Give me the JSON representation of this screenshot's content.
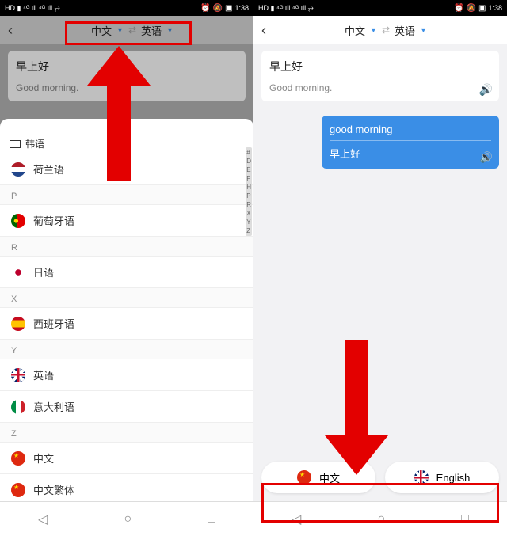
{
  "status": {
    "left": "HD ▮ ⁴ᴳ.ıll ⁴ᴳ.ıll ⥂",
    "alarm": "⏰",
    "mute": "🔕",
    "batt": "▣",
    "time": "1:38"
  },
  "top": {
    "src": "中文",
    "dst": "英语"
  },
  "leftCard": {
    "src": "早上好",
    "dst": "Good morning."
  },
  "sheetTop": "韩语",
  "sections": [
    {
      "h": "",
      "items": [
        {
          "flag": "flag-nl",
          "label": "荷兰语"
        }
      ]
    },
    {
      "h": "P",
      "items": [
        {
          "flag": "flag-pt",
          "label": "葡萄牙语"
        }
      ]
    },
    {
      "h": "R",
      "items": [
        {
          "flag": "flag-jp",
          "label": "日语"
        }
      ]
    },
    {
      "h": "X",
      "items": [
        {
          "flag": "flag-es",
          "label": "西班牙语"
        }
      ]
    },
    {
      "h": "Y",
      "items": [
        {
          "flag": "flag-uk",
          "label": "英语"
        },
        {
          "flag": "flag-it",
          "label": "意大利语"
        }
      ]
    },
    {
      "h": "Z",
      "items": [
        {
          "flag": "flag-cn",
          "label": "中文"
        },
        {
          "flag": "flag-cn",
          "label": "中文繁体"
        }
      ]
    }
  ],
  "indexBar": [
    "#",
    "D",
    "E",
    "F",
    "H",
    "P",
    "R",
    "X",
    "Y",
    "Z"
  ],
  "rightCard": {
    "src": "早上好",
    "dst": "Good morning."
  },
  "rightBubble": {
    "l1": "good morning",
    "l2": "早上好"
  },
  "langButtons": {
    "cn": "中文",
    "en": "English"
  },
  "nav": {
    "back": "◁",
    "home": "○",
    "recent": "□"
  }
}
